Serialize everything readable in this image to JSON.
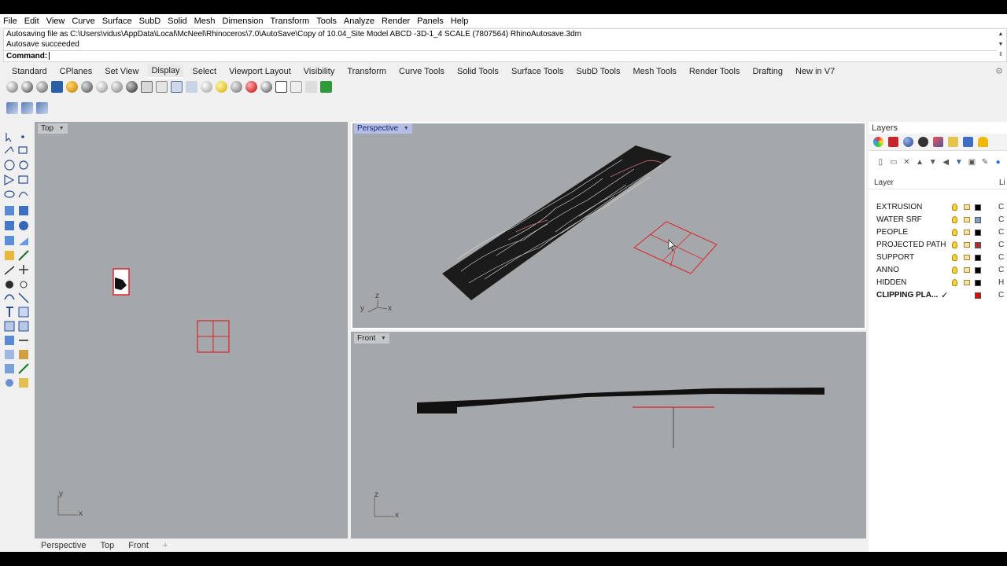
{
  "menu": [
    "File",
    "Edit",
    "View",
    "Curve",
    "Surface",
    "SubD",
    "Solid",
    "Mesh",
    "Dimension",
    "Transform",
    "Tools",
    "Analyze",
    "Render",
    "Panels",
    "Help"
  ],
  "command": {
    "history_1": "Autosaving file as C:\\Users\\vidus\\AppData\\Local\\McNeel\\Rhinoceros\\7.0\\AutoSave\\Copy of 10.04_Site Model ABCD -3D-1_4 SCALE (7807564) RhinoAutosave.3dm",
    "history_2": "Autosave succeeded",
    "prompt": "Command:"
  },
  "toolbar_tabs": [
    "Standard",
    "CPlanes",
    "Set View",
    "Display",
    "Select",
    "Viewport Layout",
    "Visibility",
    "Transform",
    "Curve Tools",
    "Solid Tools",
    "Surface Tools",
    "SubD Tools",
    "Mesh Tools",
    "Render Tools",
    "Drafting",
    "New in V7"
  ],
  "active_tab": "Display",
  "viewports": {
    "top": {
      "label": "Top"
    },
    "perspective": {
      "label": "Perspective"
    },
    "front": {
      "label": "Front"
    }
  },
  "axes": {
    "x": "x",
    "y": "y",
    "z": "z"
  },
  "bottom_tabs": [
    "Perspective",
    "Top",
    "Front"
  ],
  "layers_panel": {
    "title": "Layers",
    "header_layer": "Layer",
    "header_extra": "Li",
    "rows": [
      {
        "name": "EXTRUSION",
        "color": "#000000",
        "extra": "C"
      },
      {
        "name": "WATER SRF",
        "color": "#7f9fc8",
        "extra": "C"
      },
      {
        "name": "PEOPLE",
        "color": "#000000",
        "extra": "C"
      },
      {
        "name": "PROJECTED PATH",
        "color": "#b03030",
        "extra": "C"
      },
      {
        "name": "SUPPORT",
        "color": "#000000",
        "extra": "C"
      },
      {
        "name": "ANNO",
        "color": "#000000",
        "extra": "C"
      },
      {
        "name": "HIDDEN",
        "color": "#000000",
        "extra": "H"
      },
      {
        "name": "CLIPPING PLA...",
        "color": "#e00000",
        "extra": "C",
        "current": true
      }
    ]
  },
  "colors": {
    "viewport_bg": "#a5a8ab",
    "active_label": "#b4bde6",
    "clipping_red": "#e0202a"
  }
}
